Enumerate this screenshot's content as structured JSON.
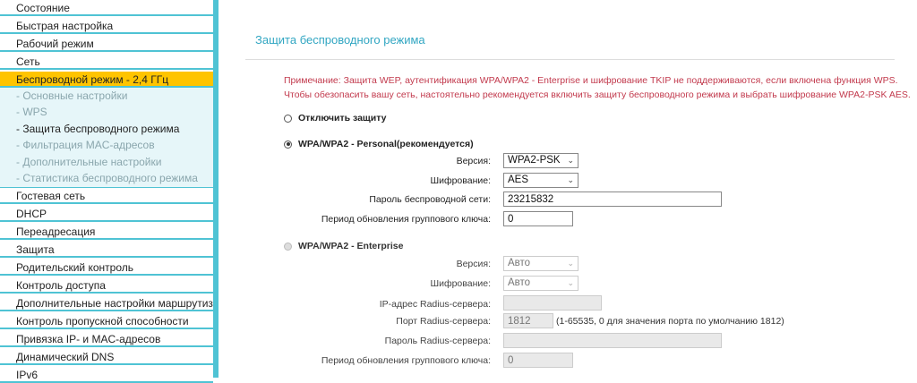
{
  "sidebar": {
    "items_top": [
      {
        "label": "Состояние"
      },
      {
        "label": "Быстрая настройка"
      },
      {
        "label": "Рабочий режим"
      },
      {
        "label": "Сеть"
      },
      {
        "label": "Беспроводной режим - 2,4 ГГц"
      }
    ],
    "sub_items": [
      {
        "label": "- Основные настройки"
      },
      {
        "label": "- WPS"
      },
      {
        "label": "- Защита беспроводного режима"
      },
      {
        "label": "- Фильтрация MAC-адресов"
      },
      {
        "label": "- Дополнительные настройки"
      },
      {
        "label": "- Статистика беспроводного режима"
      }
    ],
    "items_bottom": [
      {
        "label": "Гостевая сеть"
      },
      {
        "label": "DHCP"
      },
      {
        "label": "Переадресация"
      },
      {
        "label": "Защита"
      },
      {
        "label": "Родительский контроль"
      },
      {
        "label": "Контроль доступа"
      },
      {
        "label": "Дополнительные настройки маршрутизации"
      },
      {
        "label": "Контроль пропускной способности"
      },
      {
        "label": "Привязка IP- и MAC-адресов"
      },
      {
        "label": "Динамический DNS"
      },
      {
        "label": "IPv6"
      }
    ],
    "accent_color": "#4fc3d4",
    "active_color": "#ffc400"
  },
  "main": {
    "title": "Защита беспроводного режима",
    "note_line1": "Примечание: Защита WEP, аутентификация WPA/WPA2 - Enterprise и шифрование TKIP не поддерживаются, если включена функция WPS.",
    "note_line2": "Чтобы обезопасить вашу сеть, настоятельно рекомендуется включить защиту беспроводного режима и выбрать шифрование WPA2-PSK AES.",
    "option_disable": "Отключить защиту",
    "option_personal": "WPA/WPA2 - Personal(рекомендуется)",
    "personal": {
      "version_label": "Версия:",
      "version_value": "WPA2-PSK",
      "encryption_label": "Шифрование:",
      "encryption_value": "AES",
      "password_label": "Пароль беспроводной сети:",
      "password_value": "23215832",
      "group_key_label": "Период обновления группового ключа:",
      "group_key_value": "0"
    },
    "option_enterprise": "WPA/WPA2 - Enterprise",
    "enterprise": {
      "version_label": "Версия:",
      "version_value": "Авто",
      "encryption_label": "Шифрование:",
      "encryption_value": "Авто",
      "radius_ip_label": "IP-адрес Radius-сервера:",
      "radius_ip_value": "",
      "radius_port_label": "Порт Radius-сервера:",
      "radius_port_value": "1812",
      "radius_port_hint": "(1-65535, 0 для значения порта по умолчанию 1812)",
      "radius_password_label": "Пароль Radius-сервера:",
      "radius_password_value": "",
      "group_key_label": "Период обновления группового ключа:",
      "group_key_value": "0"
    }
  }
}
